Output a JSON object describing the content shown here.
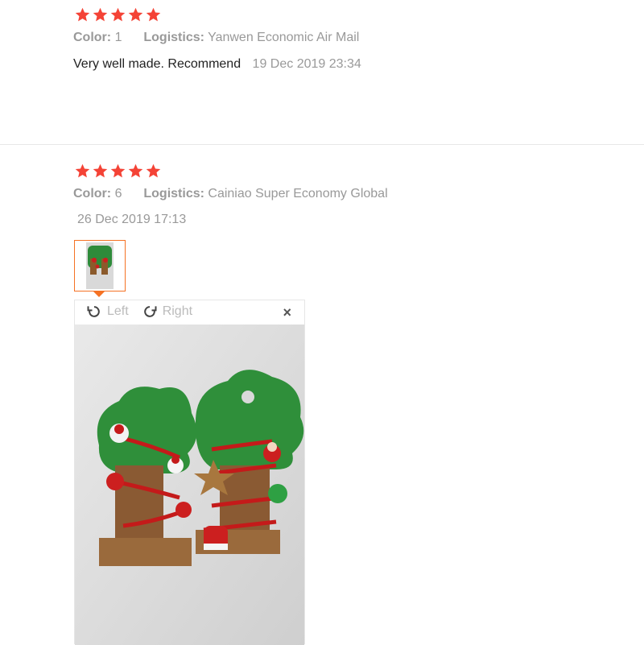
{
  "colors": {
    "star": "#f44336",
    "accent": "#f57224",
    "muted": "#999999"
  },
  "reviews": [
    {
      "rating": 5,
      "color_label": "Color:",
      "color_value": "1",
      "logistics_label": "Logistics:",
      "logistics_value": "Yanwen Economic Air Mail",
      "text": "Very well made. Recommend",
      "date": "19 Dec 2019 23:34"
    },
    {
      "rating": 5,
      "color_label": "Color:",
      "color_value": "6",
      "logistics_label": "Logistics:",
      "logistics_value": "Cainiao Super Economy Global",
      "date": "26 Dec 2019 17:13"
    }
  ],
  "viewer": {
    "rotate_left_label": "Left",
    "rotate_right_label": "Right",
    "close_icon": "×"
  }
}
